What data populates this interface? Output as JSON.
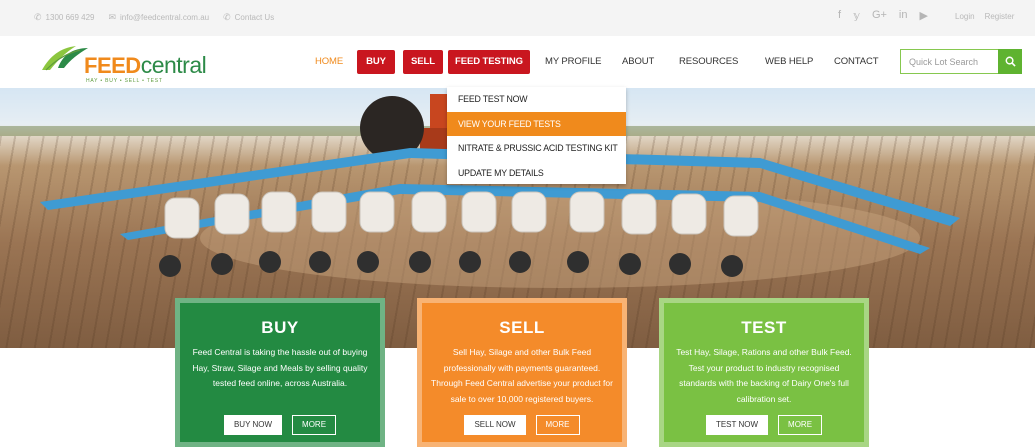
{
  "topbar": {
    "phone": "1300 669 429",
    "email": "info@feedcentral.com.au",
    "contact_us": "Contact Us",
    "social": [
      "facebook-icon",
      "twitter-icon",
      "google-plus-icon",
      "linkedin-icon",
      "youtube-icon"
    ],
    "social_glyphs": [
      "f",
      "𝕪",
      "G+",
      "in",
      "▶"
    ],
    "login": "Login",
    "register": "Register"
  },
  "logo": {
    "feed": "FEED",
    "central": "central",
    "tagline": "HAY • BUY • SELL • TEST"
  },
  "nav": {
    "home": "HOME",
    "buy": "BUY",
    "sell": "SELL",
    "feed_testing": "FEED TESTING",
    "my_profile": "MY PROFILE",
    "about": "ABOUT",
    "resources": "RESOURCES",
    "web_help": "WEB HELP",
    "contact": "CONTACT"
  },
  "search": {
    "placeholder": "Quick Lot Search"
  },
  "dropdown": {
    "items": [
      "FEED TEST NOW",
      "VIEW YOUR FEED TESTS",
      "NITRATE & PRUSSIC ACID TESTING KIT",
      "UPDATE MY DETAILS"
    ],
    "active_index": 1
  },
  "cards": {
    "buy": {
      "title": "BUY",
      "text": "Feed Central is taking the hassle out of buying Hay, Straw, Silage and Meals by selling quality tested feed online, across Australia.",
      "primary": "BUY NOW",
      "secondary": "MORE"
    },
    "sell": {
      "title": "SELL",
      "text": "Sell Hay, Silage and other Bulk Feed professionally with payments guaranteed. Through Feed Central advertise your product for sale to over 10,000 registered buyers.",
      "primary": "SELL NOW",
      "secondary": "MORE"
    },
    "test": {
      "title": "TEST",
      "text": "Test Hay, Silage, Rations and other Bulk Feed. Test your product to industry recognised standards with the backing of Dairy One's full calibration set.",
      "primary": "TEST NOW",
      "secondary": "MORE"
    }
  },
  "colors": {
    "accent_orange": "#f08a1c",
    "nav_red": "#c9161f",
    "buy_green": "#238a42",
    "sell_orange": "#f48b2a",
    "test_green": "#7ac143",
    "search_green": "#5fb330"
  }
}
